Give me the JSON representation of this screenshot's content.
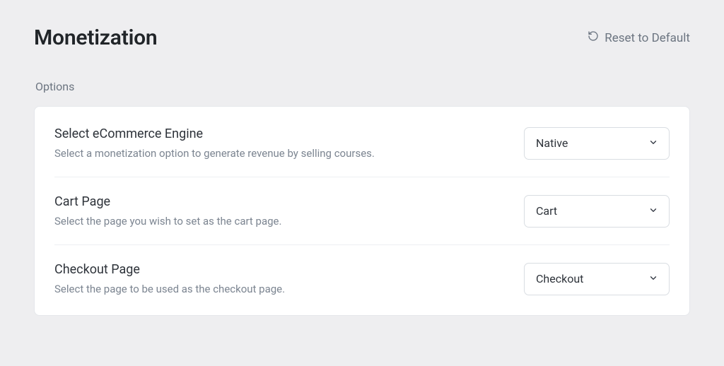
{
  "header": {
    "title": "Monetization",
    "reset_label": "Reset to Default"
  },
  "section_label": "Options",
  "options": [
    {
      "title": "Select eCommerce Engine",
      "description": "Select a monetization option to generate revenue by selling courses.",
      "selected": "Native"
    },
    {
      "title": "Cart Page",
      "description": "Select the page you wish to set as the cart page.",
      "selected": "Cart"
    },
    {
      "title": "Checkout Page",
      "description": "Select the page to be used as the checkout page.",
      "selected": "Checkout"
    }
  ]
}
